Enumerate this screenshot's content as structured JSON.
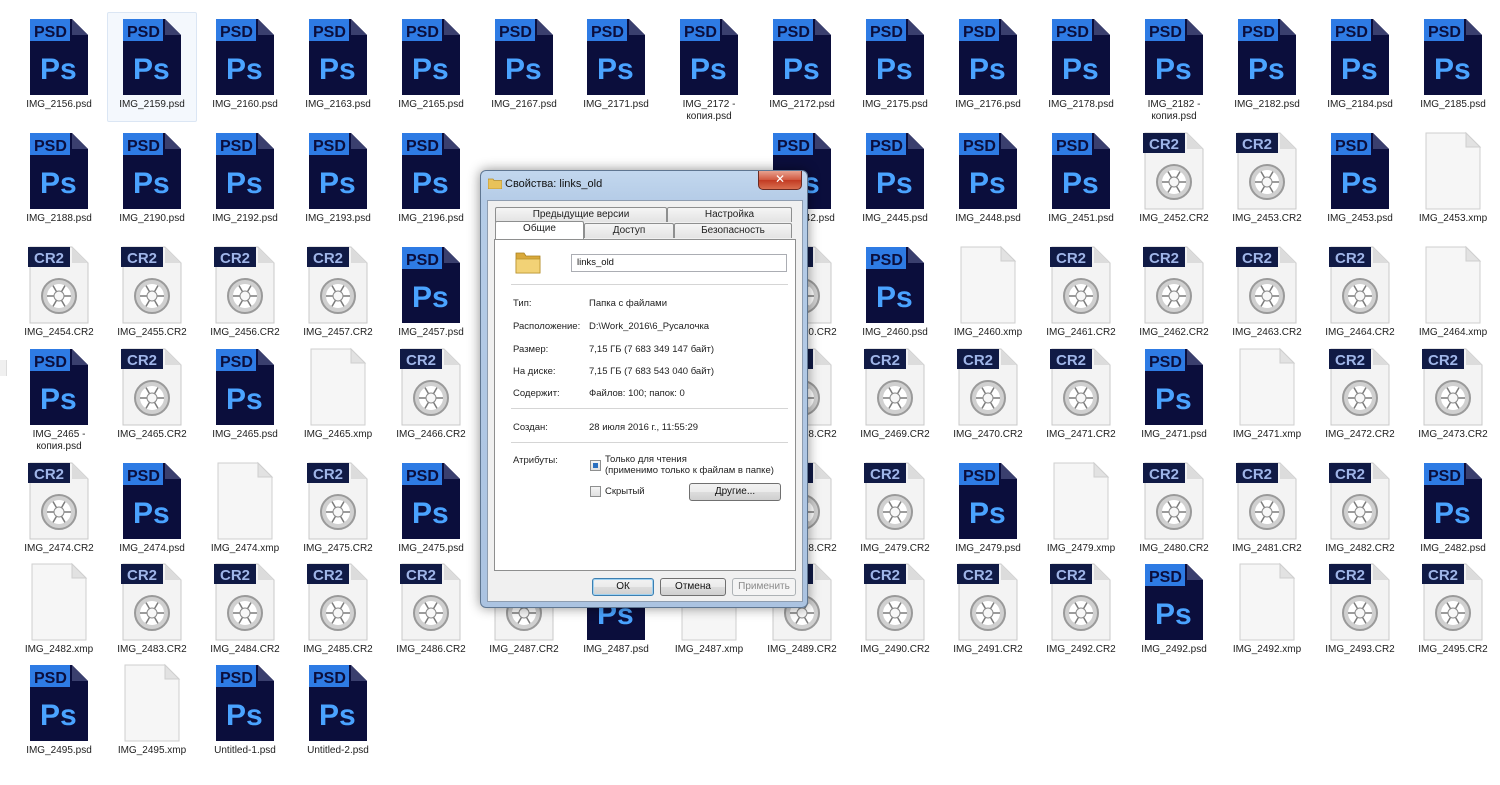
{
  "files": [
    [
      "IMG_2156.psd",
      "IMG_2159.psd",
      "IMG_2160.psd",
      "IMG_2163.psd",
      "IMG_2165.psd",
      "IMG_2167.psd",
      "IMG_2171.psd",
      "IMG_2172 -\nкопия.psd",
      "IMG_2172.psd",
      "IMG_2175.psd",
      "IMG_2176.psd",
      "IMG_2178.psd",
      "IMG_2182 -\nкопия.psd",
      "IMG_2182.psd",
      "IMG_2184.psd",
      "IMG_2185.psd"
    ],
    [
      "IMG_2188.psd",
      "IMG_2190.psd",
      "IMG_2192.psd",
      "IMG_2193.psd",
      "IMG_2196.psd",
      "",
      "",
      "",
      "IMG_2442.psd",
      "IMG_2445.psd",
      "IMG_2448.psd",
      "IMG_2451.psd",
      "IMG_2452.CR2",
      "IMG_2453.CR2",
      "IMG_2453.psd",
      "IMG_2453.xmp"
    ],
    [
      "IMG_2454.CR2",
      "IMG_2455.CR2",
      "IMG_2456.CR2",
      "IMG_2457.CR2",
      "IMG_2457.psd",
      "",
      "",
      "",
      "IMG_2460.CR2",
      "IMG_2460.psd",
      "IMG_2460.xmp",
      "IMG_2461.CR2",
      "IMG_2462.CR2",
      "IMG_2463.CR2",
      "IMG_2464.CR2",
      "IMG_2464.xmp"
    ],
    [
      "IMG_2465 -\nкопия.psd",
      "IMG_2465.CR2",
      "IMG_2465.psd",
      "IMG_2465.xmp",
      "IMG_2466.CR2",
      "",
      "",
      "",
      "IMG_2468.CR2",
      "IMG_2469.CR2",
      "IMG_2470.CR2",
      "IMG_2471.CR2",
      "IMG_2471.psd",
      "IMG_2471.xmp",
      "IMG_2472.CR2",
      "IMG_2473.CR2"
    ],
    [
      "IMG_2474.CR2",
      "IMG_2474.psd",
      "IMG_2474.xmp",
      "IMG_2475.CR2",
      "IMG_2475.psd",
      "",
      "",
      "",
      "IMG_2478.CR2",
      "IMG_2479.CR2",
      "IMG_2479.psd",
      "IMG_2479.xmp",
      "IMG_2480.CR2",
      "IMG_2481.CR2",
      "IMG_2482.CR2",
      "IMG_2482.psd"
    ],
    [
      "IMG_2482.xmp",
      "IMG_2483.CR2",
      "IMG_2484.CR2",
      "IMG_2485.CR2",
      "IMG_2486.CR2",
      "IMG_2487.CR2",
      "IMG_2487.psd",
      "IMG_2487.xmp",
      "IMG_2489.CR2",
      "IMG_2490.CR2",
      "IMG_2491.CR2",
      "IMG_2492.CR2",
      "IMG_2492.psd",
      "IMG_2492.xmp",
      "IMG_2493.CR2",
      "IMG_2495.CR2"
    ],
    [
      "IMG_2495.psd",
      "IMG_2495.xmp",
      "Untitled-1.psd",
      "Untitled-2.psd"
    ]
  ],
  "selected_file": "IMG_2159.psd",
  "icons": {
    "psd_badge": "PSD",
    "psd_glyph": "Ps",
    "cr2_badge": "CR2"
  },
  "colors": {
    "psd_dark": "#0b0e3c",
    "psd_blue": "#2e7be4",
    "cr2_dark": "#101a45"
  },
  "dialog": {
    "title": "Свойства: links_old",
    "close_glyph": "✕",
    "tabs_row1": [
      "Предыдущие версии",
      "Настройка"
    ],
    "tabs_row2": [
      "Общие",
      "Доступ",
      "Безопасность"
    ],
    "folder_name": "links_old",
    "props": {
      "type_label": "Тип:",
      "type_value": "Папка с файлами",
      "location_label": "Расположение:",
      "location_value": "D:\\Work_2016\\6_Русалочка",
      "size_label": "Размер:",
      "size_value": "7,15 ГБ (7 683 349 147 байт)",
      "disk_label": "На диске:",
      "disk_value": "7,15 ГБ (7 683 543 040 байт)",
      "contains_label": "Содержит:",
      "contains_value": "Файлов: 100; папок: 0",
      "created_label": "Создан:",
      "created_value": "28 июля 2016 г., 11:55:29",
      "attributes_label": "Атрибуты:"
    },
    "readonly_label": "Только для чтения\n(применимо только к файлам в папке)",
    "readonly_checked": true,
    "hidden_label": "Скрытый",
    "hidden_checked": false,
    "other_button": "Другие...",
    "ok_button": "ОК",
    "cancel_button": "Отмена",
    "apply_button": "Применить"
  }
}
